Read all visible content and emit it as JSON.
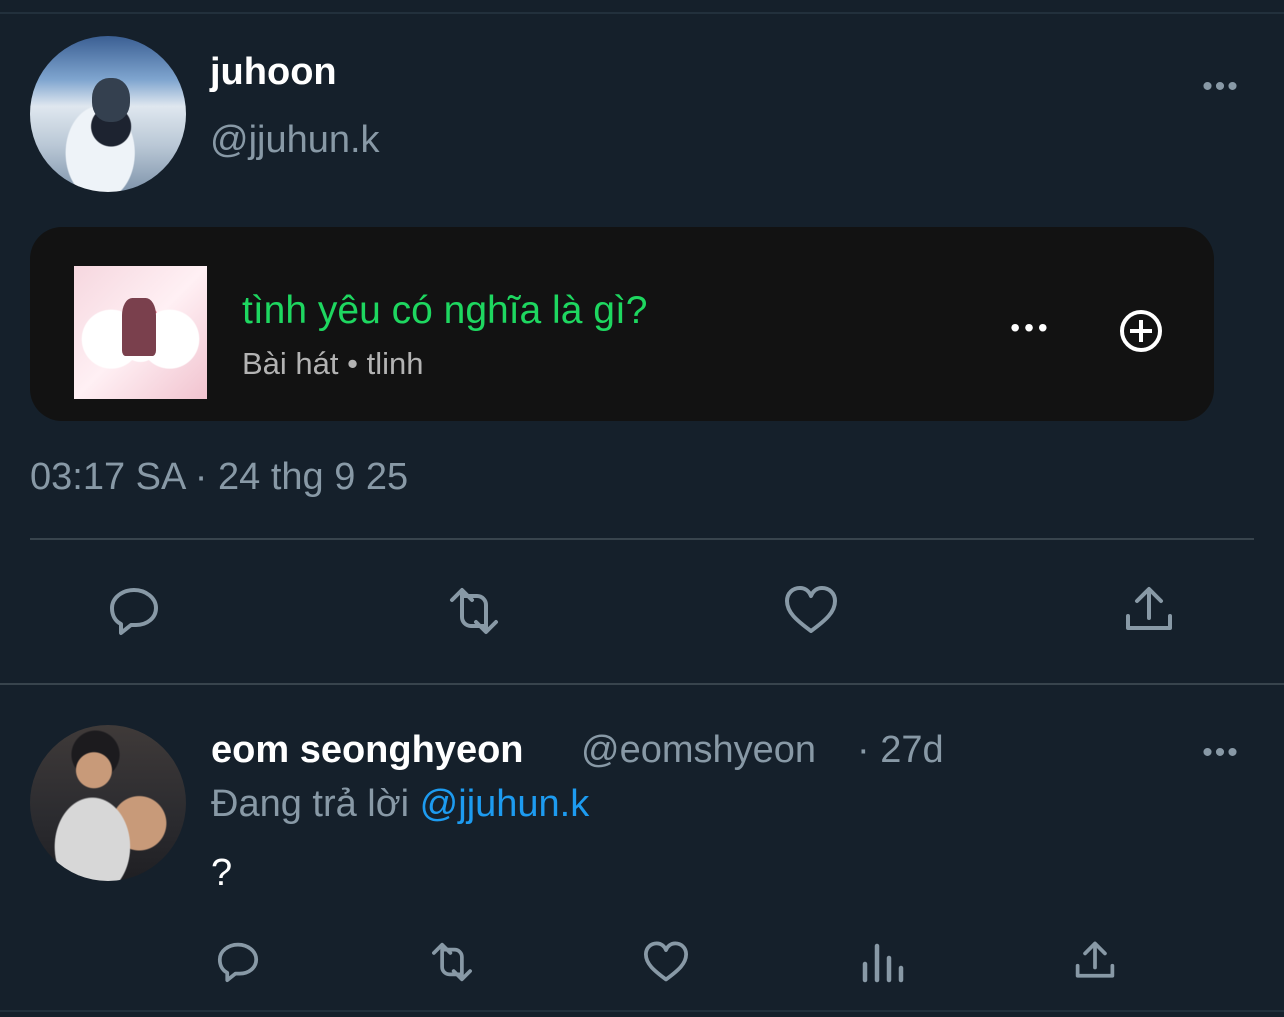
{
  "main_tweet": {
    "author_name": "juhoon",
    "author_handle": "@jjuhun.k",
    "timestamp": "03:17 SA · 24 thg 9 25",
    "more_icon": "more-horizontal-icon",
    "spotify": {
      "song_title": "tình yêu có nghĩa là gì?",
      "song_meta": "Bài hát • tlinh",
      "title_color": "#1ed760",
      "card_background": "#121212",
      "more_icon": "more-horizontal-icon",
      "add_icon": "plus-circle-icon"
    },
    "actions": [
      "reply-icon",
      "retweet-icon",
      "like-icon",
      "share-icon"
    ]
  },
  "reply_tweet": {
    "author_name": "eom seonghyeon",
    "author_handle": "@eomshyeon",
    "relative_time": "· 27d",
    "replying_prefix": "Đang trả lời",
    "replying_to": "@jjuhun.k",
    "text": "?",
    "more_icon": "more-horizontal-icon",
    "actions": [
      "reply-icon",
      "retweet-icon",
      "like-icon",
      "stats-icon",
      "share-icon"
    ]
  },
  "theme": {
    "background": "#15202b",
    "muted_text": "#8899a6",
    "link_color": "#1d9bf0",
    "divider": "#38444d"
  }
}
